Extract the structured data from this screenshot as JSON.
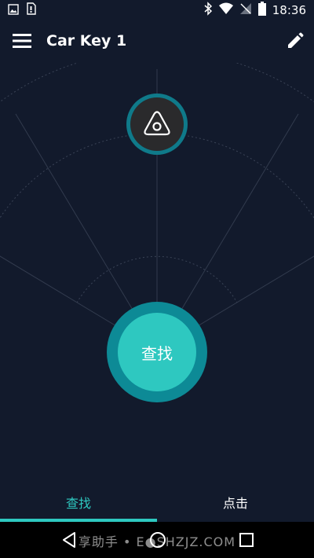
{
  "status_bar": {
    "time": "18:36",
    "left_icons": [
      "image-icon",
      "sim-card-icon"
    ],
    "right_icons": [
      "bluetooth-icon",
      "wifi-icon",
      "no-signal-icon",
      "battery-icon"
    ]
  },
  "app_bar": {
    "title": "Car Key 1",
    "menu_icon": "menu-icon",
    "edit_icon": "pencil-icon"
  },
  "radar": {
    "tag_icon": "tag-triangle-icon",
    "accent_color": "#2ec8c0",
    "ring_color": "#0d8a96",
    "find_button_label": "查找"
  },
  "tabs": [
    {
      "label": "查找",
      "active": true
    },
    {
      "label": "点击",
      "active": false
    }
  ],
  "nav_bar": {
    "icons": [
      "back-icon",
      "home-icon",
      "recent-apps-icon"
    ]
  },
  "watermark": {
    "text": "享助手 • E●SHZJZ.COM"
  }
}
